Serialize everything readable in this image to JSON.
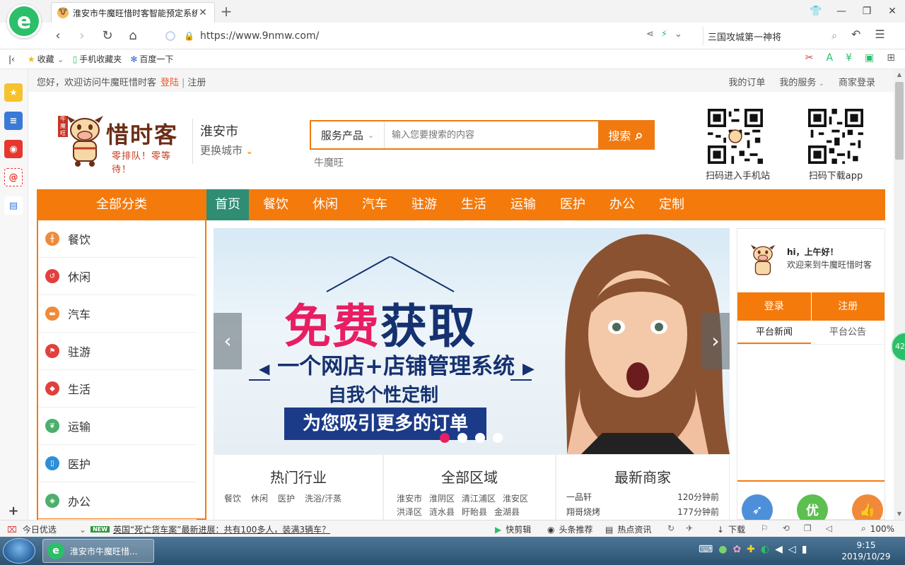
{
  "browser": {
    "tab_title": "淮安市牛魔旺惜时客智能预定系统",
    "url": "https://www.9nmw.com/",
    "search_text": "三国攻城第一神将",
    "bookmarks": [
      "收藏",
      "手机收藏夹",
      "百度一下"
    ]
  },
  "topline": {
    "greeting": "您好，欢迎访问牛魔旺惜时客",
    "login": "登陆",
    "register": "注册",
    "right_links": [
      "我的订单",
      "我的服务",
      "商家登录"
    ]
  },
  "header": {
    "logo_text": "惜时客",
    "logo_seal": "牛魔旺",
    "logo_slogan": "零排队！零等待！",
    "city": "淮安市",
    "change_city": "更换城市",
    "search_type": "服务产品",
    "search_placeholder": "输入您要搜索的内容",
    "search_button": "搜索",
    "search_hint": "牛魔旺",
    "qr_mobile_label": "扫码进入手机站",
    "qr_app_label": "扫码下载app"
  },
  "nav": {
    "all_categories": "全部分类",
    "items": [
      "首页",
      "餐饮",
      "休闲",
      "汽车",
      "驻游",
      "生活",
      "运输",
      "医护",
      "办公",
      "定制"
    ],
    "active_index": 0
  },
  "categories": [
    {
      "label": "餐饮",
      "color": "#f08a3a"
    },
    {
      "label": "休闲",
      "color": "#e2403c"
    },
    {
      "label": "汽车",
      "color": "#f08a3a"
    },
    {
      "label": "驻游",
      "color": "#e2403c"
    },
    {
      "label": "生活",
      "color": "#e2403c"
    },
    {
      "label": "运输",
      "color": "#4caf6c"
    },
    {
      "label": "医护",
      "color": "#2d8fd6"
    },
    {
      "label": "办公",
      "color": "#4caf6c"
    }
  ],
  "banner": {
    "headline_pink": "免费",
    "headline_navy": "获取",
    "line2": "一个网店+店铺管理系统",
    "line3": "自我个性定制",
    "line4": "为您吸引更多的订单",
    "slide_count": 4,
    "active_slide": 0
  },
  "sections": {
    "hot_title": "热门行业",
    "hot_links": [
      "餐饮",
      "休闲",
      "医护",
      "洗浴/汗蒸"
    ],
    "area_title": "全部区域",
    "area_links": [
      "淮安市",
      "淮阴区",
      "清江浦区",
      "淮安区",
      "洪泽区",
      "涟水县",
      "盱眙县",
      "金湖县"
    ],
    "merchant_title": "最新商家",
    "merchants": [
      {
        "name": "一品轩",
        "time": "120分钟前"
      },
      {
        "name": "翔哥烧烤",
        "time": "177分钟前"
      }
    ]
  },
  "userpanel": {
    "hi": "hi，上午好！",
    "welcome": "欢迎来到牛魔旺惜时客",
    "login": "登录",
    "register": "注册",
    "tabs": [
      "平台新闻",
      "平台公告"
    ],
    "icon_you": "优"
  },
  "float_badge": "42",
  "statusbar": {
    "today": "今日优选",
    "news_badge": "NEW",
    "news": "英国“死亡货车案”最新进展：共有100多人，装满3辆车？",
    "tools": [
      "快剪辑",
      "头条推荐",
      "热点资讯",
      "下载"
    ],
    "zoom": "100%"
  },
  "taskbar": {
    "app_label": "淮安市牛魔旺惜...",
    "time": "9:15",
    "date": "2019/10/29"
  }
}
